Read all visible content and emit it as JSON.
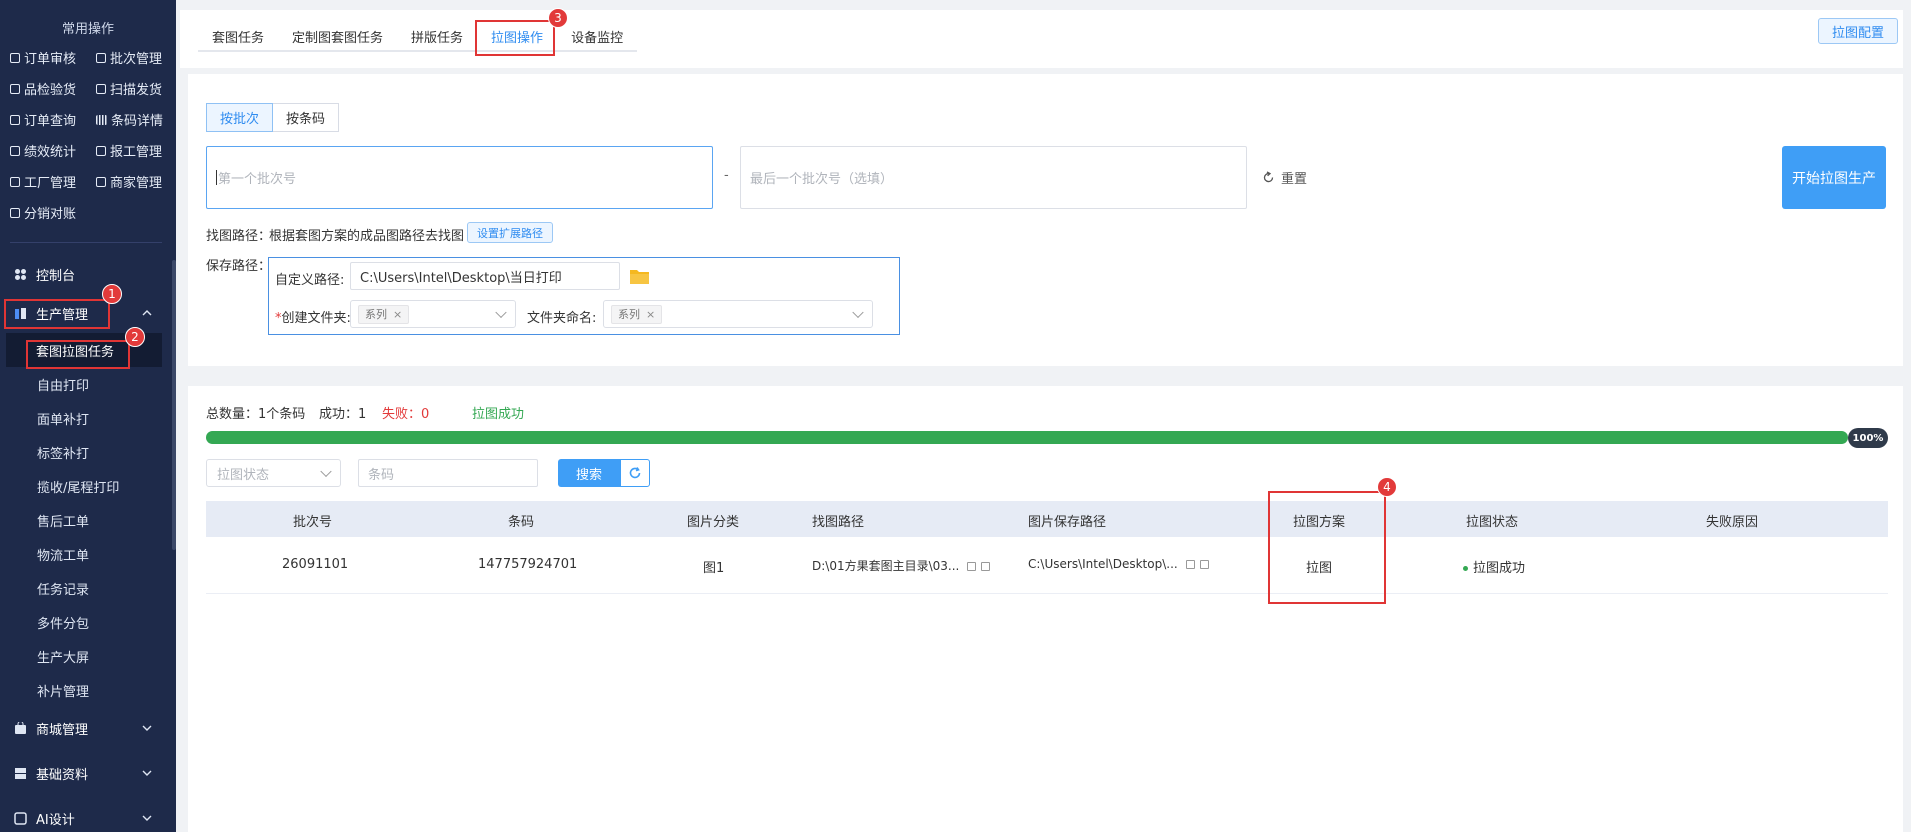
{
  "sidebar": {
    "quick_title": "常用操作",
    "quick_items": [
      "订单审核",
      "批次管理",
      "品检验货",
      "扫描发货",
      "订单查询",
      "条码详情",
      "绩效统计",
      "报工管理",
      "工厂管理",
      "商家管理",
      "分销对账"
    ],
    "menu": {
      "dashboard": "控制台",
      "production": "生产管理",
      "sub_items": [
        "套图拉图任务",
        "自由打印",
        "面单补打",
        "标签补打",
        "揽收/尾程打印",
        "售后工单",
        "物流工单",
        "任务记录",
        "多件分包",
        "生产大屏",
        "补片管理"
      ],
      "mall": "商城管理",
      "basic": "基础资料",
      "ai": "AI设计"
    }
  },
  "annotations": [
    "1",
    "2",
    "3",
    "4"
  ],
  "tabs": [
    "套图任务",
    "定制图套图任务",
    "拼版任务",
    "拉图操作",
    "设备监控"
  ],
  "config_button": "拉图配置",
  "mode_buttons": [
    "按批次",
    "按条码"
  ],
  "batch_start_placeholder": "第一个批次号",
  "batch_end_placeholder": "最后一个批次号（选填）",
  "dash": "-",
  "reset_label": "重置",
  "start_button": "开始拉图生产",
  "find_path": {
    "label": "找图路径：",
    "desc": "根据套图方案的成品图路径去找图",
    "set_button": "设置扩展路径"
  },
  "save_path": {
    "label": "保存路径：",
    "custom_label": "自定义路径:",
    "custom_value": "C:\\Users\\Intel\\Desktop\\当日打印",
    "create_folder_label": "创建文件夹:",
    "create_folder_star": "*",
    "create_folder_tag": "系列",
    "folder_name_label": "文件夹命名:",
    "folder_name_tag": "系列",
    "tag_close": "×"
  },
  "stats": {
    "total": "总数量：1个条码",
    "success": "成功：1",
    "fail": "失败：0",
    "result": "拉图成功"
  },
  "progress": {
    "percent": 100,
    "label": "100%"
  },
  "filter": {
    "status_placeholder": "拉图状态",
    "barcode_placeholder": "条码",
    "search_button": "搜索"
  },
  "table": {
    "headers": [
      "批次号",
      "条码",
      "图片分类",
      "找图路径",
      "图片保存路径",
      "拉图方案",
      "拉图状态",
      "失败原因"
    ],
    "rows": [
      {
        "batch": "26091101",
        "barcode": "147757924701",
        "category": "图1",
        "find_path": "D:\\01方果套图主目录\\03...",
        "save_path": "C:\\Users\\Intel\\Desktop\\...",
        "plan": "拉图",
        "status": "拉图成功",
        "reason": ""
      }
    ]
  },
  "colors": {
    "sidebar_bg": "#1e2a4a",
    "accent": "#3f9ef6",
    "success": "#34a853",
    "fail": "#e23a3a",
    "highlight": "#e03535"
  }
}
